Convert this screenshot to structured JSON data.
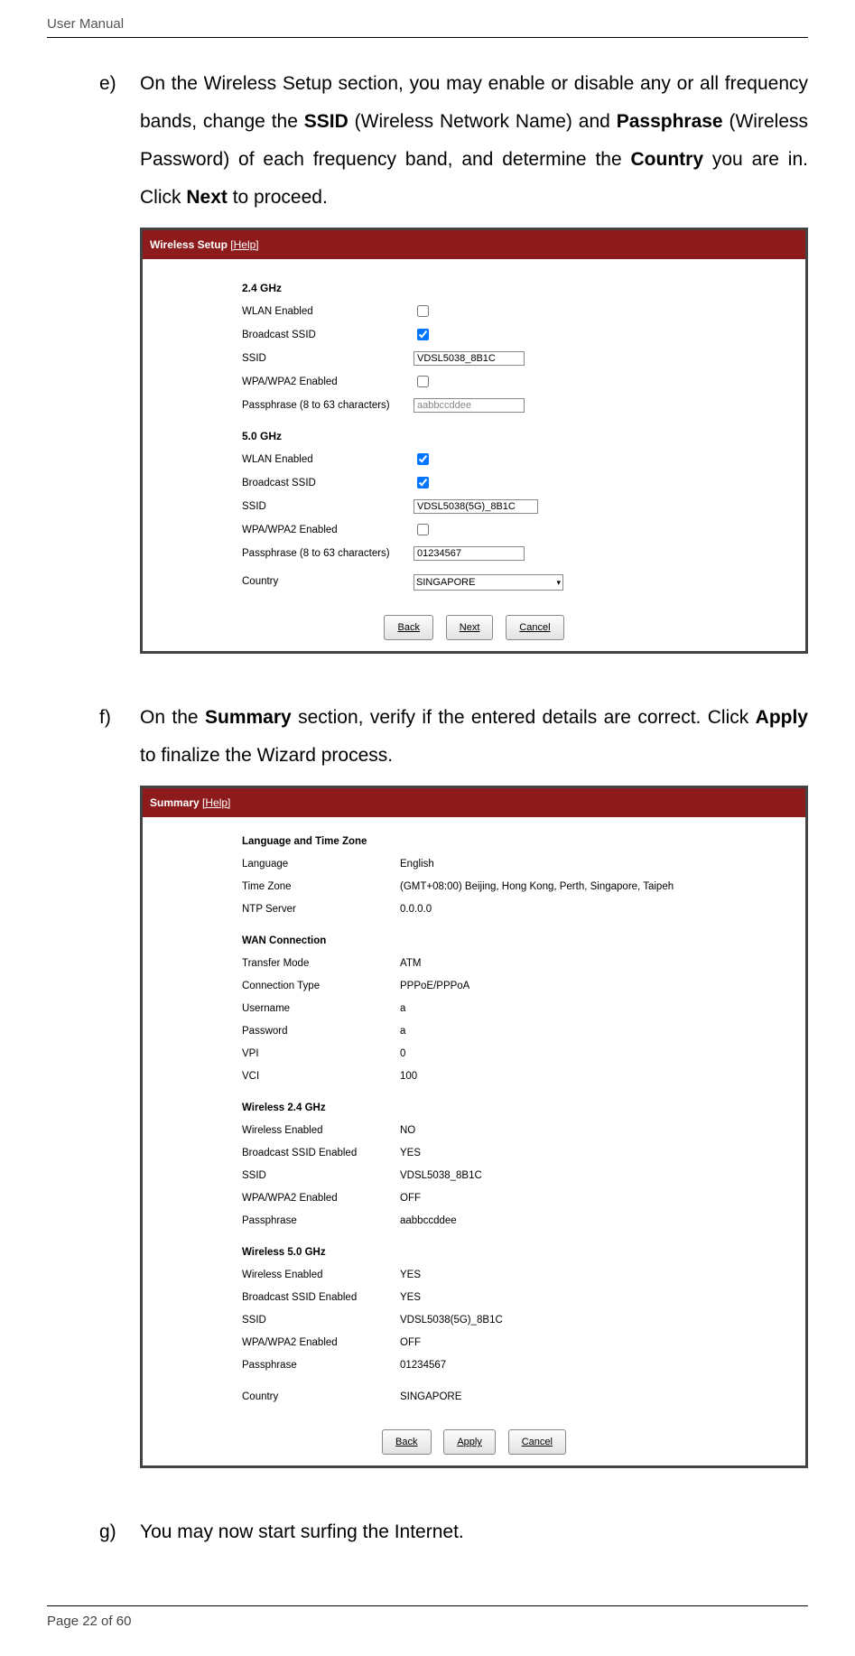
{
  "header": {
    "title": "User Manual"
  },
  "footer": {
    "page_label": "Page 22 of 60"
  },
  "item_e": {
    "marker": "e)",
    "t1": "On the Wireless Setup section, you may enable or disable any or all frequency bands, change the ",
    "b1": "SSID",
    "t2": " (Wireless Network Name) and ",
    "b2": "Passphrase",
    "t3": " (Wireless Password) of each frequency band, and determine the ",
    "b3": "Country",
    "t4": " you are in. Click ",
    "b4": "Next",
    "t5": " to proceed."
  },
  "wireless": {
    "title": "Wireless Setup",
    "help": "[Help]",
    "g24": {
      "heading": "2.4 GHz",
      "wlan_enabled_label": "WLAN Enabled",
      "wlan_enabled": false,
      "broadcast_label": "Broadcast SSID",
      "broadcast": true,
      "ssid_label": "SSID",
      "ssid_value": "VDSL5038_8B1C",
      "wpa_label": "WPA/WPA2 Enabled",
      "wpa_enabled": false,
      "pass_label": "Passphrase (8 to 63 characters)",
      "pass_value": "aabbccddee"
    },
    "g50": {
      "heading": "5.0 GHz",
      "wlan_enabled_label": "WLAN Enabled",
      "wlan_enabled": true,
      "broadcast_label": "Broadcast SSID",
      "broadcast": true,
      "ssid_label": "SSID",
      "ssid_value": "VDSL5038(5G)_8B1C",
      "wpa_label": "WPA/WPA2 Enabled",
      "wpa_enabled": false,
      "pass_label": "Passphrase (8 to 63 characters)",
      "pass_value": "01234567"
    },
    "country_label": "Country",
    "country_value": "SINGAPORE",
    "btn_back": "Back",
    "btn_next": "Next",
    "btn_cancel": "Cancel"
  },
  "item_f": {
    "marker": "f)",
    "t1": "On the ",
    "b1": "Summary",
    "t2": " section, verify if the entered details are correct. Click ",
    "b2": "Apply",
    "t3": " to finalize the Wizard process."
  },
  "summary": {
    "title": "Summary",
    "help": "[Help]",
    "lang_zone_heading": "Language and Time Zone",
    "language_label": "Language",
    "language_value": "English",
    "tz_label": "Time Zone",
    "tz_value": "(GMT+08:00) Beijing, Hong Kong, Perth, Singapore, Taipeh",
    "ntp_label": "NTP Server",
    "ntp_value": "0.0.0.0",
    "wan_heading": "WAN Connection",
    "transfer_label": "Transfer Mode",
    "transfer_value": "ATM",
    "conn_label": "Connection Type",
    "conn_value": "PPPoE/PPPoA",
    "user_label": "Username",
    "user_value": "a",
    "pass_label": "Password",
    "pass_value": "a",
    "vpi_label": "VPI",
    "vpi_value": "0",
    "vci_label": "VCI",
    "vci_value": "100",
    "w24_heading": "Wireless 2.4 GHz",
    "w24_enabled_label": "Wireless Enabled",
    "w24_enabled_value": "NO",
    "w24_bssid_label": "Broadcast SSID Enabled",
    "w24_bssid_value": "YES",
    "w24_ssid_label": "SSID",
    "w24_ssid_value": "VDSL5038_8B1C",
    "w24_wpa_label": "WPA/WPA2 Enabled",
    "w24_wpa_value": "OFF",
    "w24_pass_label": "Passphrase",
    "w24_pass_value": "aabbccddee",
    "w50_heading": "Wireless 5.0 GHz",
    "w50_enabled_label": "Wireless Enabled",
    "w50_enabled_value": "YES",
    "w50_bssid_label": "Broadcast SSID Enabled",
    "w50_bssid_value": "YES",
    "w50_ssid_label": "SSID",
    "w50_ssid_value": "VDSL5038(5G)_8B1C",
    "w50_wpa_label": "WPA/WPA2 Enabled",
    "w50_wpa_value": "OFF",
    "w50_pass_label": "Passphrase",
    "w50_pass_value": "01234567",
    "country_label": "Country",
    "country_value": "SINGAPORE",
    "btn_back": "Back",
    "btn_apply": "Apply",
    "btn_cancel": "Cancel"
  },
  "item_g": {
    "marker": "g)",
    "text": "You may now start surfing the Internet."
  }
}
